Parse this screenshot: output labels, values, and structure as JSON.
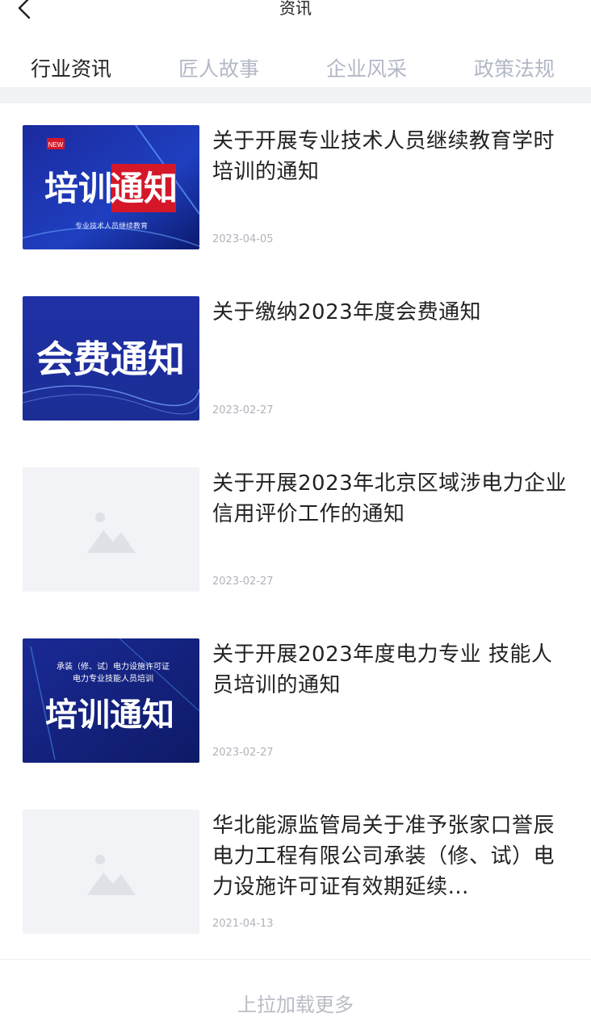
{
  "header": {
    "title": "资讯"
  },
  "tabs": [
    {
      "label": "行业资讯"
    },
    {
      "label": "匠人故事"
    },
    {
      "label": "企业风采"
    },
    {
      "label": "政策法规"
    }
  ],
  "articles": [
    {
      "title": "关于开展专业技术人员继续教育学时培训的通知",
      "date": "2023-04-05",
      "thumb": {
        "badge": "NEW",
        "text_a": "培训",
        "text_b": "通知",
        "subtitle": "专业技术人员继续教育"
      }
    },
    {
      "title": "关于缴纳2023年度会费通知",
      "date": "2023-02-27",
      "thumb": {
        "text": "会费通知"
      }
    },
    {
      "title": "关于开展2023年北京区域涉电力企业 信用评价工作的通知",
      "date": "2023-02-27"
    },
    {
      "title": "关于开展2023年度电力专业 技能人员培训的通知",
      "date": "2023-02-27",
      "thumb": {
        "line1": "承装（修、试）电力设施许可证",
        "line2": "电力专业技能人员培训",
        "text": "培训通知"
      }
    },
    {
      "title": "华北能源监管局关于准予张家口誉辰电力工程有限公司承装（修、试）电力设施许可证有效期延续…",
      "date": "2021-04-13"
    }
  ],
  "footer": {
    "load_more": "上拉加载更多"
  },
  "colors": {
    "active_tab": "#222222",
    "inactive_tab": "#b3b8c6",
    "banner_blue": "#1d2fa8",
    "badge_red": "#d4182a"
  }
}
